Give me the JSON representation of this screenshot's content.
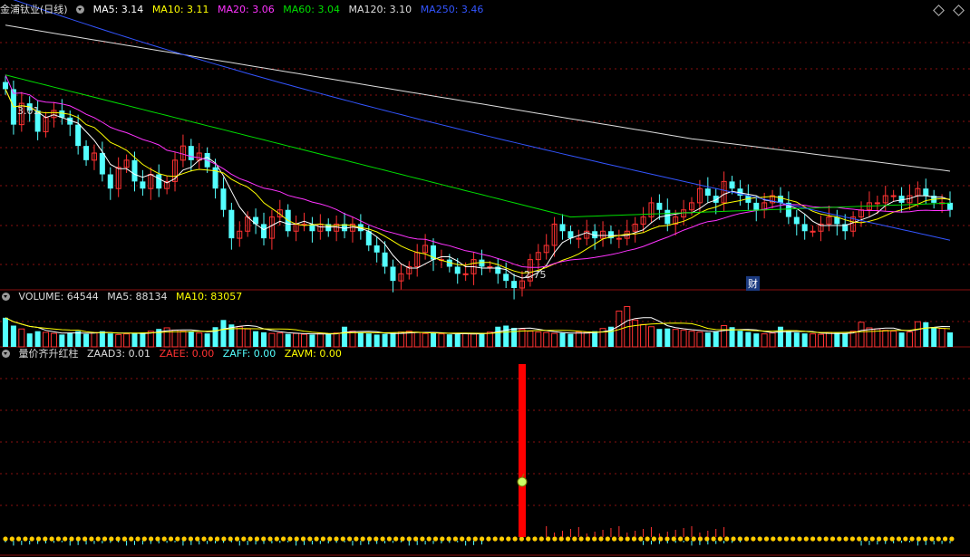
{
  "main_header": {
    "stock": "金浦钛业(日线)",
    "ma": [
      {
        "label": "MA5: 3.14",
        "color": "#ffffff"
      },
      {
        "label": "MA10: 3.11",
        "color": "#ffff00"
      },
      {
        "label": "MA20: 3.06",
        "color": "#ff33ff"
      },
      {
        "label": "MA60: 3.04",
        "color": "#00e000"
      },
      {
        "label": "MA120: 3.10",
        "color": "#dddddd"
      },
      {
        "label": "MA250: 3.46",
        "color": "#3355ff"
      }
    ]
  },
  "volume_header": {
    "title": "VOLUME: 64544",
    "ma5": "MA5: 88134",
    "ma10": "MA10: 83057"
  },
  "indicator_header": {
    "name": "量价齐升红柱",
    "zaad3": "ZAAD3: 0.01",
    "zaee": "ZAEE: 0.00",
    "zaff": "ZAFF: 0.00",
    "zavm": "ZAVM: 0.00"
  },
  "annotations": {
    "high_label": "3.01",
    "low_label": "2.75",
    "cai_label": "财"
  },
  "colors": {
    "up": "#ff3232",
    "down": "#54ffff",
    "ma5": "#ffffff",
    "ma10": "#ffff00",
    "ma20": "#ff33ff",
    "ma60": "#00e000",
    "ma120": "#dddddd",
    "ma250": "#3355ff",
    "grid": "#8a1010",
    "signal_bar": "#ff0000"
  },
  "chart_data": {
    "type": "candlestick",
    "price_range": [
      2.72,
      3.1
    ],
    "closes": [
      3.0,
      2.95,
      2.98,
      2.97,
      2.94,
      2.96,
      2.97,
      2.96,
      2.95,
      2.92,
      2.9,
      2.91,
      2.88,
      2.86,
      2.89,
      2.9,
      2.87,
      2.86,
      2.88,
      2.86,
      2.87,
      2.9,
      2.92,
      2.9,
      2.91,
      2.89,
      2.86,
      2.83,
      2.79,
      2.8,
      2.82,
      2.81,
      2.79,
      2.82,
      2.83,
      2.8,
      2.81,
      2.81,
      2.8,
      2.81,
      2.8,
      2.81,
      2.8,
      2.81,
      2.8,
      2.78,
      2.77,
      2.75,
      2.73,
      2.74,
      2.75,
      2.77,
      2.78,
      2.76,
      2.76,
      2.75,
      2.74,
      2.74,
      2.76,
      2.75,
      2.75,
      2.74,
      2.73,
      2.72,
      2.73,
      2.76,
      2.77,
      2.78,
      2.81,
      2.8,
      2.79,
      2.79,
      2.8,
      2.79,
      2.8,
      2.79,
      2.79,
      2.8,
      2.81,
      2.82,
      2.84,
      2.83,
      2.81,
      2.82,
      2.83,
      2.84,
      2.86,
      2.85,
      2.84,
      2.87,
      2.86,
      2.85,
      2.84,
      2.83,
      2.84,
      2.85,
      2.84,
      2.82,
      2.81,
      2.8,
      2.8,
      2.81,
      2.82,
      2.81,
      2.8,
      2.82,
      2.83,
      2.84,
      2.84,
      2.85,
      2.85,
      2.84,
      2.85,
      2.86,
      2.85,
      2.84,
      2.84,
      2.83
    ],
    "volumes": [
      130000,
      95000,
      80000,
      60000,
      70000,
      65000,
      60000,
      55000,
      62000,
      70000,
      58000,
      64000,
      70000,
      60000,
      55000,
      58000,
      62000,
      64000,
      70000,
      80000,
      85000,
      75000,
      70000,
      68000,
      62000,
      60000,
      88000,
      120000,
      100000,
      90000,
      80000,
      70000,
      65000,
      60000,
      62000,
      58000,
      60000,
      56000,
      55000,
      60000,
      58000,
      62000,
      90000,
      70000,
      64000,
      60000,
      55000,
      58000,
      62000,
      66000,
      70000,
      65000,
      60000,
      62000,
      58000,
      56000,
      57000,
      60000,
      58000,
      62000,
      66000,
      90000,
      95000,
      85000,
      78000,
      70000,
      66000,
      64000,
      60000,
      62000,
      58000,
      66000,
      64000,
      70000,
      82000,
      90000,
      160000,
      180000,
      120000,
      100000,
      90000,
      80000,
      82000,
      78000,
      74000,
      70000,
      66000,
      64000,
      68000,
      95000,
      88000,
      72000,
      66000,
      60000,
      58000,
      62000,
      90000,
      70000,
      64000,
      60000,
      58000,
      56000,
      64000,
      62000,
      60000,
      70000,
      110000,
      85000,
      80000,
      74000,
      70000,
      64000,
      66000,
      112000,
      110000,
      85000,
      82000,
      64544
    ],
    "indicator": {
      "signal_index": 64,
      "zaad3": 0.01,
      "zaee": 0.0,
      "zaff": 0.0,
      "zavm": 0.0
    }
  }
}
